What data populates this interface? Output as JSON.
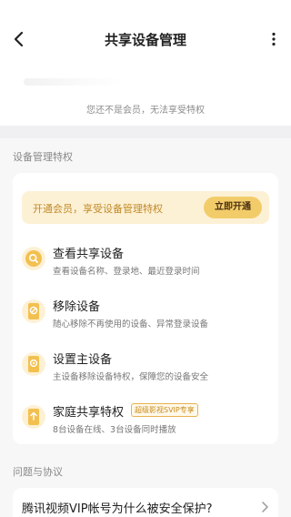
{
  "header": {
    "title": "共享设备管理"
  },
  "profile": {
    "membership_hint": "您还不是会员，无法享受特权"
  },
  "sections": {
    "device_privileges": "设备管理特权",
    "faq": "问题与协议"
  },
  "promo": {
    "text": "开通会员，享受设备管理特权",
    "button": "立即开通"
  },
  "features": [
    {
      "title": "查看共享设备",
      "desc": "查看设备名称、登录地、最近登录时间",
      "icon": "search-icon"
    },
    {
      "title": "移除设备",
      "desc": "随心移除不再使用的设备、异常登录设备",
      "icon": "remove-device-icon"
    },
    {
      "title": "设置主设备",
      "desc": "主设备移除设备特权，保障您的设备安全",
      "icon": "main-device-icon"
    },
    {
      "title": "家庭共享特权",
      "desc": "8台设备在线、3台设备同时播放",
      "badge": "超级影视SVIP专享",
      "icon": "family-share-icon"
    }
  ],
  "faq": {
    "question": "腾讯视频VIP帐号为什么被安全保护?"
  },
  "colors": {
    "accent": "#f3cc6a",
    "promo_bg": "#fdf1d5",
    "promo_text": "#c08a2a"
  }
}
